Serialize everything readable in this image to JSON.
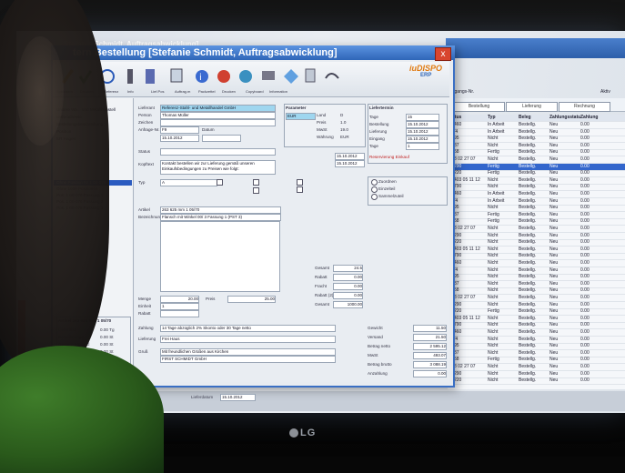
{
  "window_title": "Stefanie Schmidt, Auftragsabwicklung]",
  "dialog_title": "tern Bestellung  [Stefanie Schmidt, Auftragsabwicklung]",
  "close_glyph": "x",
  "logo": {
    "top": "iuDISPO",
    "bottom": "ERP"
  },
  "toolbar_labels": [
    "Speichern",
    "Drucken",
    "Referenz",
    "Info",
    "Lief.Pos",
    "Auftrag.m",
    "Packzettel",
    "Drucken",
    "Copyboard",
    "Information"
  ],
  "nav_items": [
    "Unsere Wa... und Metallbaustell",
    "Lieferadresse",
    "Bestellungsbeschreibung",
    "Position",
    "ER Hagen"
  ],
  "nav_items2": [
    "Ohne Position Nr 1 00-076",
    "Ohne 1000 Positionen",
    "Pos. 1 00-076 Fassung 1",
    "Pos. 1 00-076 Fassung 2",
    "Pos. 1 00-076 Fassung 3"
  ],
  "form": {
    "lieferant_label": "Lieferant",
    "lieferant_value": "Referenz-Stahl- und Metallhandel GmbH",
    "person_label": "Person",
    "person_value": "Thomas Müller",
    "zeichen_label": "Zeichen",
    "anfrage_label": "Anfrage-Nr.",
    "anfrage_value": "F9",
    "datum_label": "Datum",
    "datum_value": "15.10.2012",
    "status_label": "Status",
    "kopftext_label": "Kopftext",
    "kopftext_value": "Kontakt bestellen wir zur Lieferung gemäß unseren Einkaufsbedingungen zu Preisen wie folgt:",
    "typ_label": "Typ",
    "typ_value": "A",
    "artikel_label": "Artikel",
    "artikel_value": "263 625 mm 1 05/70",
    "bezeichnung_label": "Bezeichnung",
    "bezeichnung_value": "Flansch mit Winkel 00/ 3 Fassung 1 (PST 3)",
    "menge_label": "Menge",
    "menge_value": "20.00",
    "preis_label": "Preis",
    "preis_value": "25.00",
    "einheit_label": "Einheit",
    "einheit_value": "1",
    "rabatt_label": "Rabatt",
    "zahlung_label": "Zahlung",
    "zahlung_value": "14 Tage abzüglich 2% Skonto oder 30 Tage netto",
    "lieferung_label": "Lieferung",
    "lieferung_value": "Frei Haus",
    "gruss_label": "Gruß",
    "gruss_value": "Mit freundlichen Grüßen aus Kirchen",
    "gruss_value2": "FIRST SCHMIDT GmbH"
  },
  "panel_liefertermin": {
    "title": "Liefertermin",
    "rows": [
      [
        "Tage",
        "15"
      ],
      [
        "Bestellung",
        "15.10.2012"
      ],
      [
        "Lieferung",
        "15.10.2012"
      ],
      [
        "Eingang",
        "15.10.2012"
      ],
      [
        "Tage",
        "1"
      ]
    ],
    "footer": "Reservierung Einkauf"
  },
  "panel_params": {
    "title": "Parameter",
    "rows": [
      [
        "Land",
        "D"
      ],
      [
        "Preis",
        "1.0"
      ],
      [
        "MwSt",
        "19.0"
      ],
      [
        "Währung",
        "EUR"
      ]
    ]
  },
  "dates": {
    "a": "15.10.2012",
    "b": "15.10.2012"
  },
  "radios": [
    "Zuordnen",
    "Einzelteil",
    "Sammelzuteil"
  ],
  "status_bar": "Bestellungsnummer 1 Anzahl",
  "totals_left": [
    [
      "Gesamt",
      "24.5"
    ],
    [
      "Rabatt",
      "0.00"
    ],
    [
      "Fracht",
      "0.00"
    ],
    [
      "Rabatt (2)",
      "0.00"
    ],
    [
      "Gesamt",
      "1000.00"
    ]
  ],
  "totals_right": [
    [
      "Gewicht",
      "11.50"
    ],
    [
      "Versand",
      "21.50"
    ],
    [
      "Betrag netto",
      "2 595.12"
    ],
    [
      "MwSt",
      "493.07"
    ],
    [
      "Betrag brutto",
      "3 088.19"
    ],
    [
      "Anzahlung",
      "0.00"
    ]
  ],
  "summary_box": {
    "title": "Artikel 263 625 mm 1 05/70",
    "rows": [
      [
        "Lieferfrist",
        "0.00 Tg"
      ],
      [
        "Bestellmenge",
        "0.00 St"
      ],
      [
        "Gesamt-Bestand",
        "0.00 St"
      ],
      [
        "Offene Bestell.",
        "0.00 St"
      ],
      [
        "Gesamt",
        "24.5 0.00"
      ]
    ]
  },
  "bottom_bar": [
    "Lieferdatum",
    "15.10.2012"
  ],
  "bg_header": {
    "tabs": [
      "Bestellung",
      "Lieferung",
      "Rechnung"
    ],
    "vorgang_label": "Vorgangs-Nr.",
    "aktiv_label": "Aktiv"
  },
  "bg_columns": [
    "Status",
    "Typ",
    "Beleg",
    "Zahlungsstatus",
    "Zahlung"
  ],
  "bg_rows": [
    [
      "In Arbeit",
      "Bestellg.",
      "Neu",
      "0.00"
    ],
    [
      "In Arbeit",
      "Bestellg.",
      "Neu",
      "0.00"
    ],
    [
      "Nicht",
      "Bestellg.",
      "Neu",
      "0.00"
    ],
    [
      "Nicht",
      "Bestellg.",
      "Neu",
      "0.00"
    ],
    [
      "Fertig",
      "Bestellg.",
      "Neu",
      "0.00"
    ],
    [
      "Nicht",
      "Bestellg.",
      "Neu",
      "0.00"
    ],
    [
      "Fertig",
      "Bestellg.",
      "Neu",
      "0.00"
    ],
    [
      "Fertig",
      "Bestellg.",
      "Neu",
      "0.00"
    ],
    [
      "Nicht",
      "Bestellg.",
      "Neu",
      "0.00"
    ],
    [
      "Nicht",
      "Bestellg.",
      "Neu",
      "0.00"
    ],
    [
      "In Arbeit",
      "Bestellg.",
      "Neu",
      "0.00"
    ],
    [
      "In Arbeit",
      "Bestellg.",
      "Neu",
      "0.00"
    ],
    [
      "Nicht",
      "Bestellg.",
      "Neu",
      "0.00"
    ],
    [
      "Fertig",
      "Bestellg.",
      "Neu",
      "0.00"
    ],
    [
      "Fertig",
      "Bestellg.",
      "Neu",
      "0.00"
    ],
    [
      "Nicht",
      "Bestellg.",
      "Neu",
      "0.00"
    ],
    [
      "Nicht",
      "Bestellg.",
      "Neu",
      "0.00"
    ],
    [
      "Nicht",
      "Bestellg.",
      "Neu",
      "0.00"
    ],
    [
      "Nicht",
      "Bestellg.",
      "Neu",
      "0.00"
    ],
    [
      "Nicht",
      "Bestellg.",
      "Neu",
      "0.00"
    ],
    [
      "Nicht",
      "Bestellg.",
      "Neu",
      "0.00"
    ],
    [
      "Nicht",
      "Bestellg.",
      "Neu",
      "0.00"
    ],
    [
      "Nicht",
      "Bestellg.",
      "Neu",
      "0.00"
    ],
    [
      "Nicht",
      "Bestellg.",
      "Neu",
      "0.00"
    ],
    [
      "Nicht",
      "Bestellg.",
      "Neu",
      "0.00"
    ],
    [
      "Nicht",
      "Bestellg.",
      "Neu",
      "0.00"
    ],
    [
      "Nicht",
      "Bestellg.",
      "Neu",
      "0.00"
    ],
    [
      "Fertig",
      "Bestellg.",
      "Neu",
      "0.00"
    ],
    [
      "Nicht",
      "Bestellg.",
      "Neu",
      "0.00"
    ],
    [
      "Nicht",
      "Bestellg.",
      "Neu",
      "0.00"
    ],
    [
      "Nicht",
      "Bestellg.",
      "Neu",
      "0.00"
    ],
    [
      "Nicht",
      "Bestellg.",
      "Neu",
      "0.00"
    ],
    [
      "Nicht",
      "Bestellg.",
      "Neu",
      "0.00"
    ],
    [
      "Nicht",
      "Bestellg.",
      "Neu",
      "0.00"
    ],
    [
      "Fertig",
      "Bestellg.",
      "Neu",
      "0.00"
    ],
    [
      "Nicht",
      "Bestellg.",
      "Neu",
      "0.00"
    ],
    [
      "Nicht",
      "Bestellg.",
      "Neu",
      "0.00"
    ],
    [
      "Nicht",
      "Bestellg.",
      "Neu",
      "0.00"
    ]
  ],
  "bg_left_codes": [
    "1/7460",
    "1/4/4",
    "1/295",
    "1/387",
    "1/958",
    "1/98 02 27 07",
    "1/3290",
    "1/3220",
    "1/4403 05 11 12",
    "1/6790"
  ],
  "monitor_brand": "LG",
  "colors": {
    "titlebar": "#2f66b8",
    "selection": "#3366cc",
    "status_red": "#d32a1a",
    "logo_orange": "#e07a10"
  }
}
